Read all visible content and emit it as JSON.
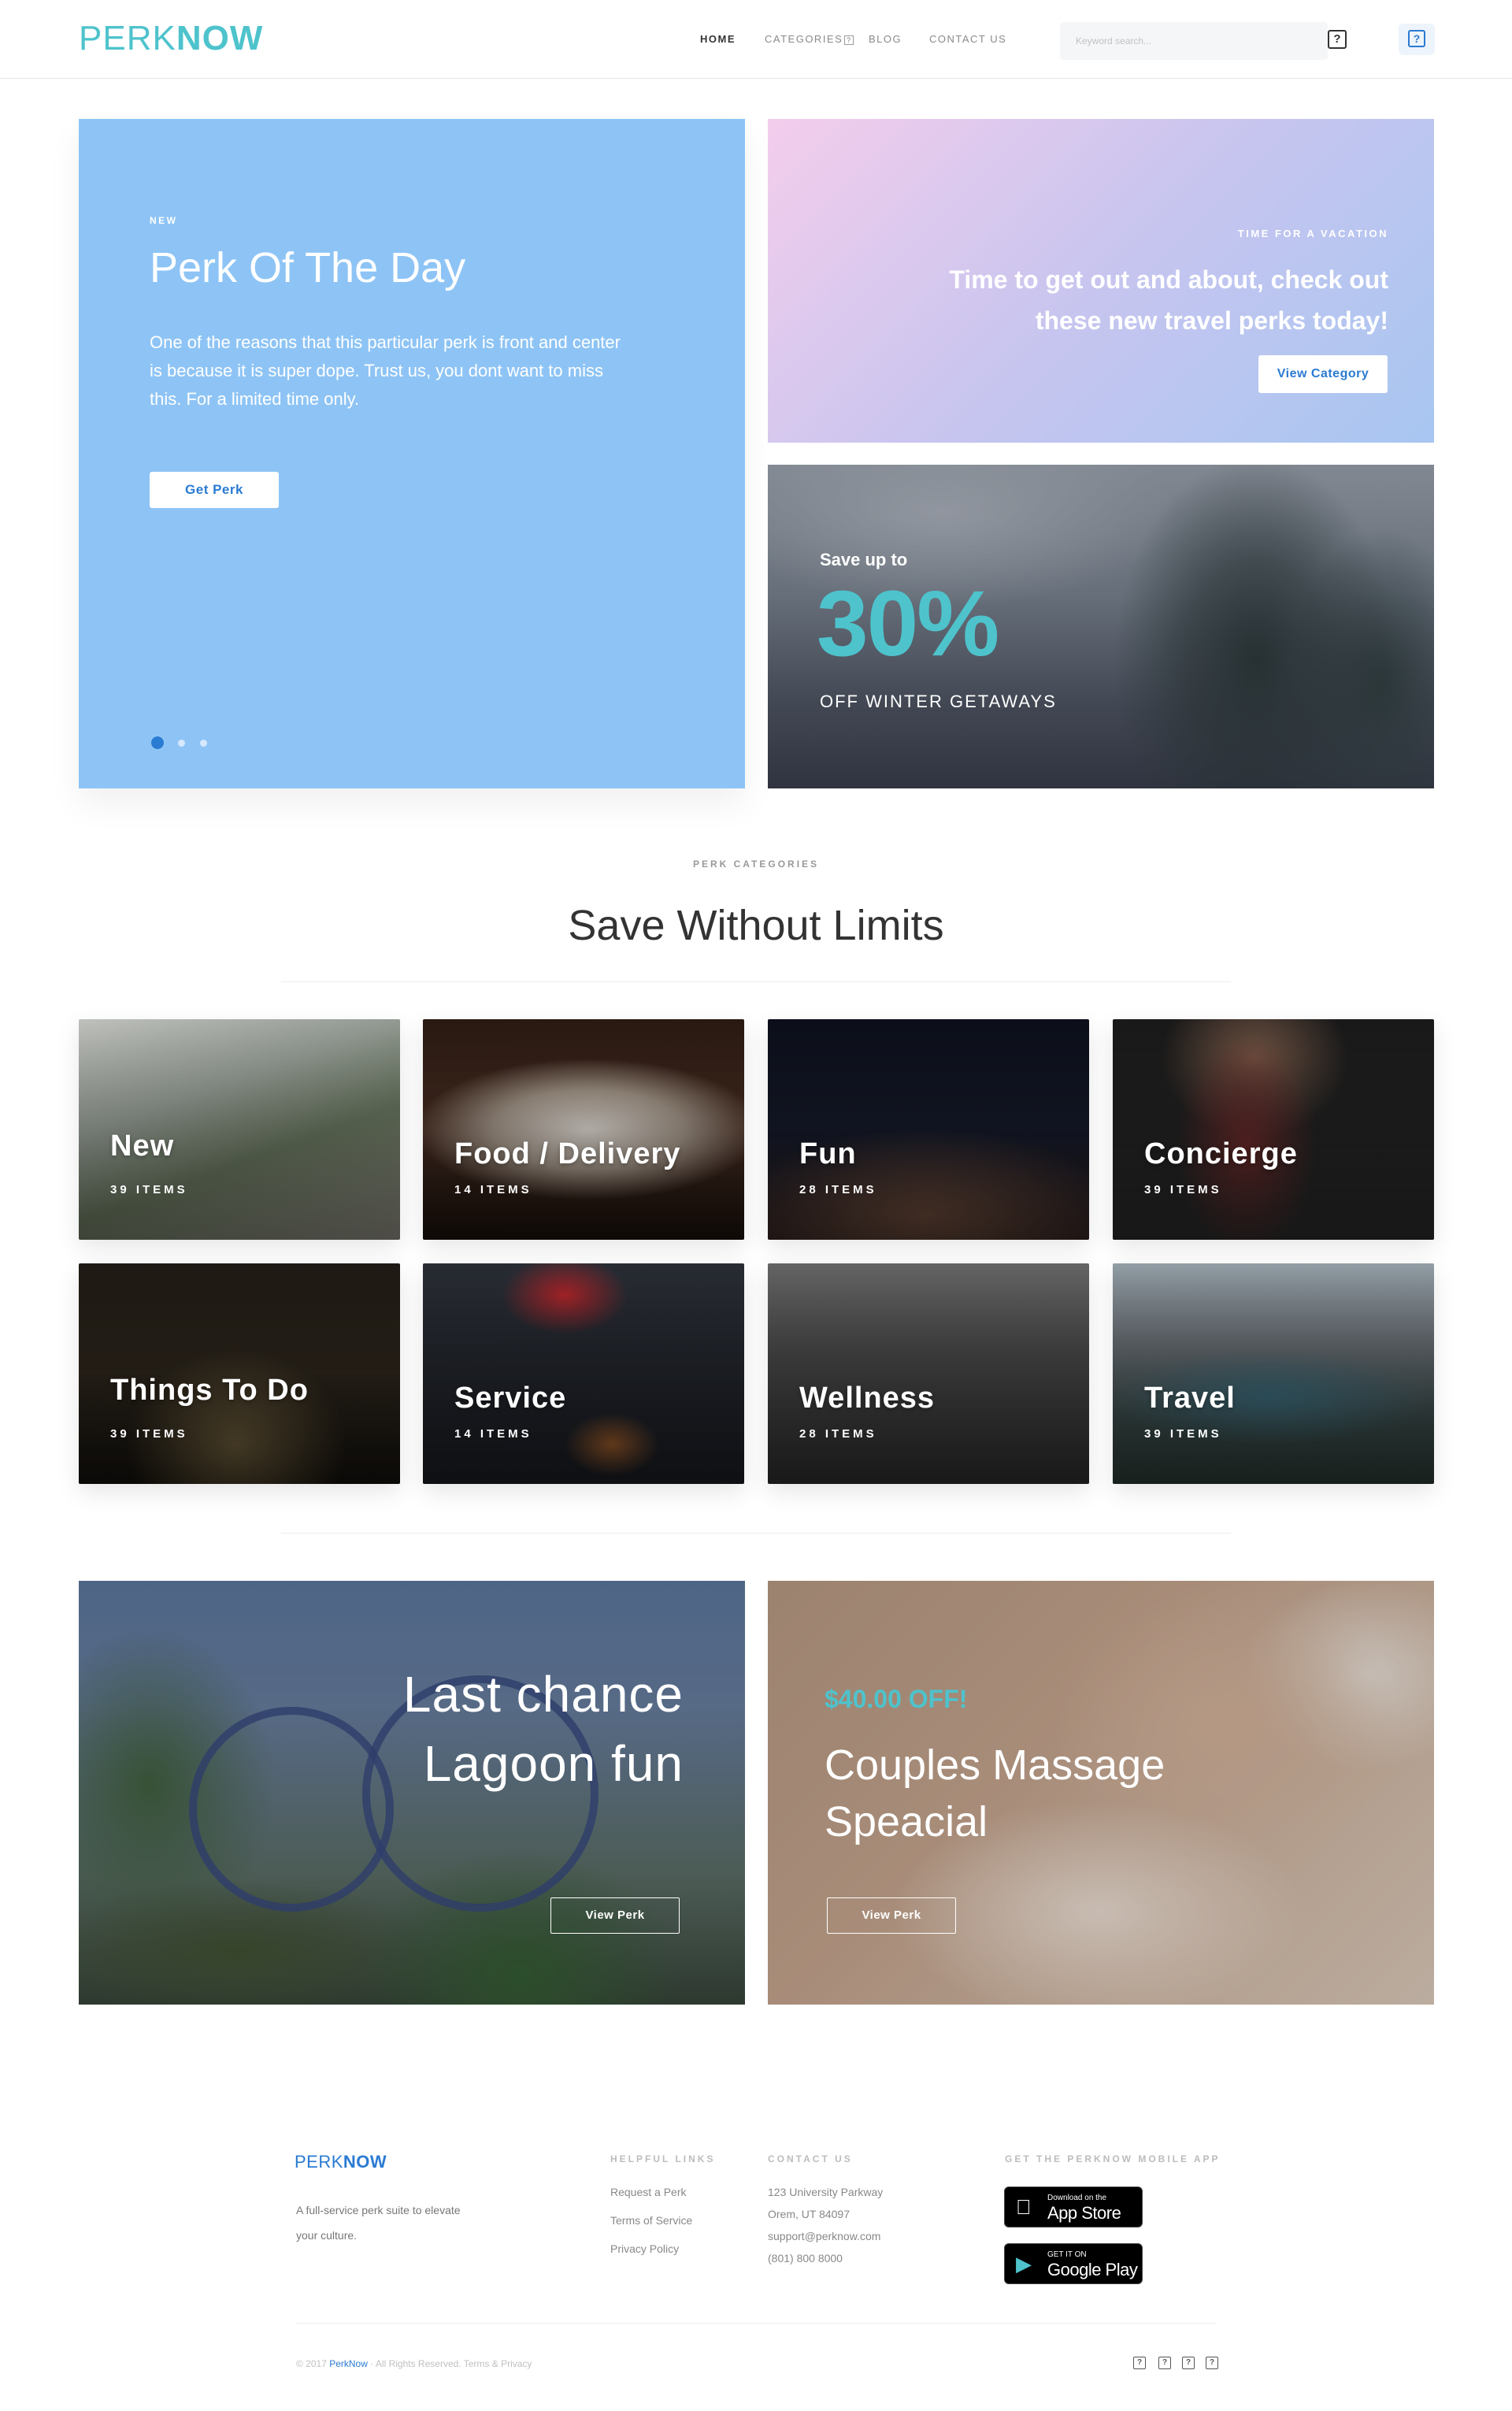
{
  "header": {
    "logo": {
      "light": "PERK",
      "bold": "NOW"
    },
    "nav": [
      {
        "label": "HOME",
        "active": true
      },
      {
        "label": "CATEGORIES",
        "active": false,
        "has_dropdown": true
      },
      {
        "label": "BLOG",
        "active": false
      },
      {
        "label": "CONTACT US",
        "active": false
      }
    ],
    "search_placeholder": "Keyword search...",
    "search_icon": "?",
    "help_icon": "?"
  },
  "hero": {
    "main": {
      "eyebrow": "NEW",
      "title": "Perk Of The Day",
      "body": "One of the reasons that this particular perk is front and center is because it is super dope.  Trust us, you dont want to miss this.  For a limited time only.",
      "button": "Get Perk",
      "slides": 3,
      "active_slide": 1
    },
    "vacation": {
      "eyebrow": "TIME FOR A VACATION",
      "headline": "Time to get out and about, check out these new travel perks today!",
      "button": "View Category"
    },
    "winter": {
      "pre": "Save up to",
      "big": "30%",
      "sub": "OFF WINTER GETAWAYS"
    }
  },
  "categories": {
    "eyebrow": "PERK CATEGORIES",
    "title": "Save Without Limits",
    "items": [
      {
        "name": "New",
        "count": "39 ITEMS"
      },
      {
        "name": "Food / Delivery",
        "count": "14 ITEMS"
      },
      {
        "name": "Fun",
        "count": "28 ITEMS"
      },
      {
        "name": "Concierge",
        "count": "39 ITEMS"
      },
      {
        "name": "Things To Do",
        "count": "39 ITEMS"
      },
      {
        "name": "Service",
        "count": "14 ITEMS"
      },
      {
        "name": "Wellness",
        "count": "28 ITEMS"
      },
      {
        "name": "Travel",
        "count": "39 ITEMS"
      }
    ]
  },
  "promos": {
    "lagoon": {
      "line1": "Last chance",
      "line2": "Lagoon fun",
      "button": "View Perk"
    },
    "massage": {
      "off": "$40.00 OFF!",
      "line1": "Couples Massage",
      "line2": "Speacial",
      "button": "View Perk"
    }
  },
  "footer": {
    "logo": {
      "light": "PERK",
      "bold": "NOW"
    },
    "tagline_1": "A full-service perk suite to elevate",
    "tagline_2": "your culture.",
    "helpful_links": {
      "heading": "HELPFUL LINKS",
      "links": [
        "Request a Perk",
        "Terms of Service",
        "Privacy Policy"
      ]
    },
    "contact": {
      "heading": "CONTACT US",
      "address1": "123 University Parkway",
      "address2": "Orem, UT 84097",
      "email": "support@perknow.com",
      "phone": "(801) 800 8000"
    },
    "app": {
      "heading": "GET THE PERKNOW MOBILE APP",
      "app_store_small": "Download on the",
      "app_store_big": "App Store",
      "google_small": "GET IT ON",
      "google_big": "Google Play"
    },
    "copyright_prefix": "© 2017",
    "copyright_brand": "PerkNow",
    "copyright_suffix": "· All Rights Reserved. Terms & Privacy",
    "social_icon": "?"
  },
  "colors": {
    "accent": "#4ec3cc",
    "brand_blue": "#2a7bd2",
    "hero_blue": "#8ec4f5"
  }
}
